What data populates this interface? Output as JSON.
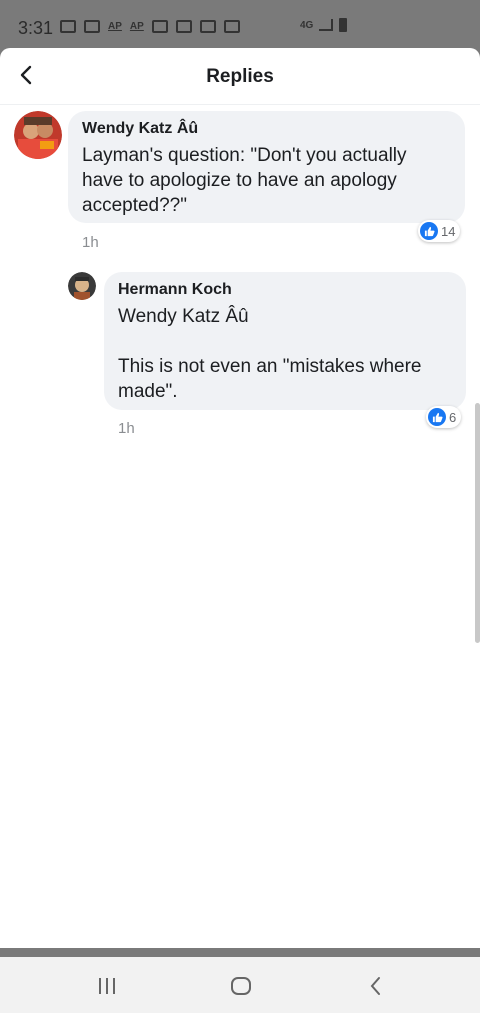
{
  "status_bar": {
    "time": "3:31",
    "network": "4G"
  },
  "header": {
    "title": "Replies"
  },
  "comments": [
    {
      "author": "Wendy Katz Âû",
      "text": "Layman's question: \"Don't you actually have to apologize to have an apology accepted??\"",
      "time": "1h",
      "reactions": "14"
    },
    {
      "author": "Hermann Koch",
      "text": "Wendy Katz Âû\n\nThis is not even an \"mistakes where made\".",
      "time": "1h",
      "reactions": "6"
    }
  ],
  "colors": {
    "like_blue": "#1877f2",
    "bubble_bg": "#f0f2f5",
    "status_bg": "#7a7a7a"
  }
}
